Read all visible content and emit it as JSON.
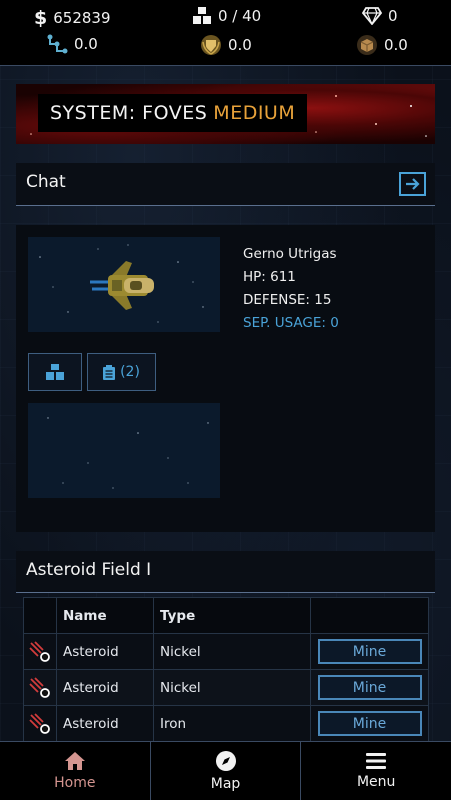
{
  "stats": {
    "credits": "652839",
    "cargo": "0 / 40",
    "gems": "0",
    "stat_a": "0.0",
    "stat_b": "0.0",
    "stat_c": "0.0"
  },
  "system": {
    "label": "SYSTEM: FOVES",
    "security": "MEDIUM",
    "security_color": "#e8a23a"
  },
  "chat": {
    "title": "Chat",
    "open_icon": "arrow-right-box-icon"
  },
  "ship": {
    "name": "Gerno Utrigas",
    "hp": "HP: 611",
    "defense": "DEFENSE: 15",
    "sep_usage": "SEP. USAGE: 0",
    "cargo_button_icon": "cargo-boxes-icon",
    "log_button_label": "(2)",
    "log_button_icon": "clipboard-icon"
  },
  "field": {
    "title": "Asteroid Field I",
    "columns": [
      "",
      "Name",
      "Type",
      ""
    ],
    "rows": [
      {
        "name": "Asteroid",
        "type": "Nickel",
        "action": "Mine"
      },
      {
        "name": "Asteroid",
        "type": "Nickel",
        "action": "Mine"
      },
      {
        "name": "Asteroid",
        "type": "Iron",
        "action": "Mine"
      }
    ]
  },
  "nav": [
    {
      "label": "Home",
      "icon": "home-icon",
      "active": true
    },
    {
      "label": "Map",
      "icon": "compass-icon",
      "active": false
    },
    {
      "label": "Menu",
      "icon": "hamburger-menu-icon",
      "active": false
    }
  ],
  "colors": {
    "accent": "#4aa3d8",
    "active_nav": "#d49590",
    "banner_red": "#8b1010"
  }
}
